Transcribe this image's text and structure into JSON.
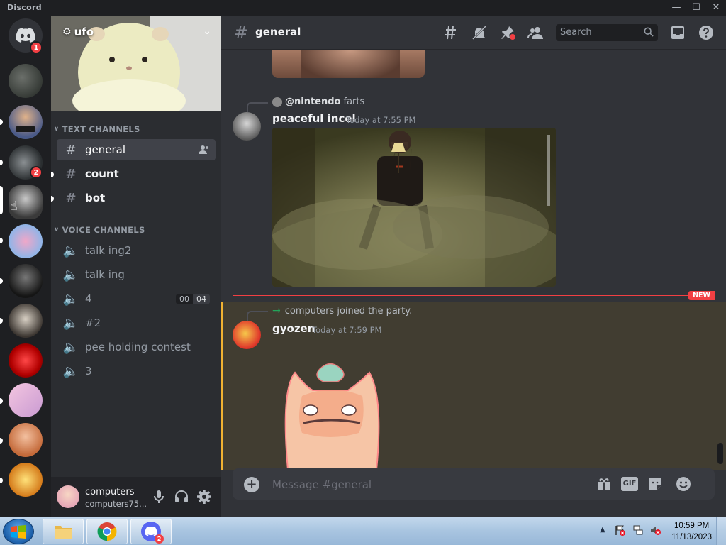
{
  "window": {
    "app_name": "Discord",
    "minimize": "—",
    "maximize": "☐",
    "close": "✕"
  },
  "servers": {
    "home_badge": "1",
    "badge_4": "2"
  },
  "sidebar": {
    "server_name": "ufo",
    "categories": {
      "text": "TEXT CHANNELS",
      "voice": "VOICE CHANNELS"
    },
    "text_channels": [
      {
        "label": "general"
      },
      {
        "label": "count"
      },
      {
        "label": "bot"
      }
    ],
    "voice_channels": [
      {
        "label": "talk ing2"
      },
      {
        "label": "talk ing"
      },
      {
        "label": "4",
        "count_left": "00",
        "count_right": "04"
      },
      {
        "label": "#2"
      },
      {
        "label": "pee holding contest"
      },
      {
        "label": "3"
      }
    ]
  },
  "user_panel": {
    "name": "computers",
    "tag": "computers75..."
  },
  "header": {
    "channel": "general",
    "search_placeholder": "Search"
  },
  "messages": [
    {
      "reply_to": "@nintendo",
      "reply_text": "farts",
      "author": "peaceful incel",
      "time": "Today at 7:55 PM"
    },
    {
      "system": "computers joined the party.",
      "author": "gyozen",
      "time": "Today at 7:59 PM"
    }
  ],
  "new_marker": "NEW",
  "composer": {
    "placeholder": "Message #general",
    "gif_label": "GIF"
  },
  "taskbar": {
    "time": "10:59 PM",
    "date": "11/13/2023",
    "discord_badge": "2"
  },
  "colors": {
    "accent": "#5865f2",
    "danger": "#f23f43",
    "mention": "#f0b232"
  }
}
